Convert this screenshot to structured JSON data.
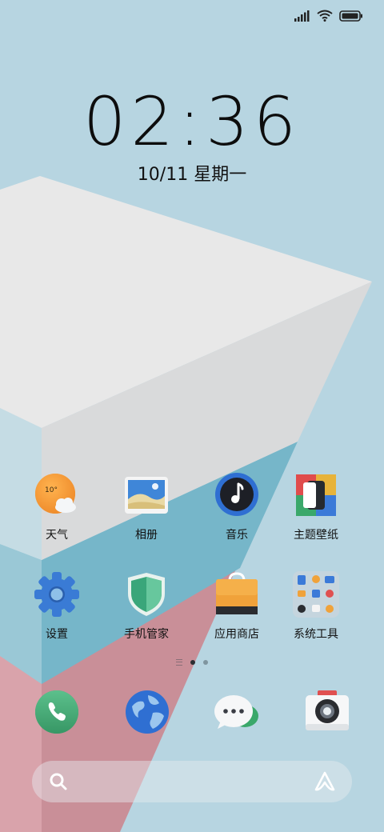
{
  "status_bar": {
    "signal_icon": "signal-bars-icon",
    "wifi_icon": "wifi-icon",
    "battery_icon": "battery-icon",
    "battery_level": 1.0
  },
  "clock": {
    "time": "02:36",
    "date": "10/11 星期一"
  },
  "apps": {
    "weather": {
      "label": "天气",
      "temp": "10°"
    },
    "gallery": {
      "label": "相册"
    },
    "music": {
      "label": "音乐"
    },
    "themes": {
      "label": "主题壁纸"
    },
    "settings": {
      "label": "设置"
    },
    "security": {
      "label": "手机管家"
    },
    "app_store": {
      "label": "应用商店"
    },
    "system_tools": {
      "label": "系统工具"
    }
  },
  "page_indicator": {
    "pages": 2,
    "active": 1
  },
  "dock": {
    "phone_icon": "phone-icon",
    "browser_icon": "globe-icon",
    "messages_icon": "chat-bubble-icon",
    "camera_icon": "camera-icon"
  },
  "search": {
    "search_icon": "search-icon",
    "assistant_icon": "assistant-icon"
  },
  "colors": {
    "wallpaper_bg": "#b7d5e1",
    "cube_top": "#e8e8e8",
    "cube_side": "#d9dadb",
    "teal_band": "#74b4c8",
    "pink_band": "#cc8f97"
  }
}
